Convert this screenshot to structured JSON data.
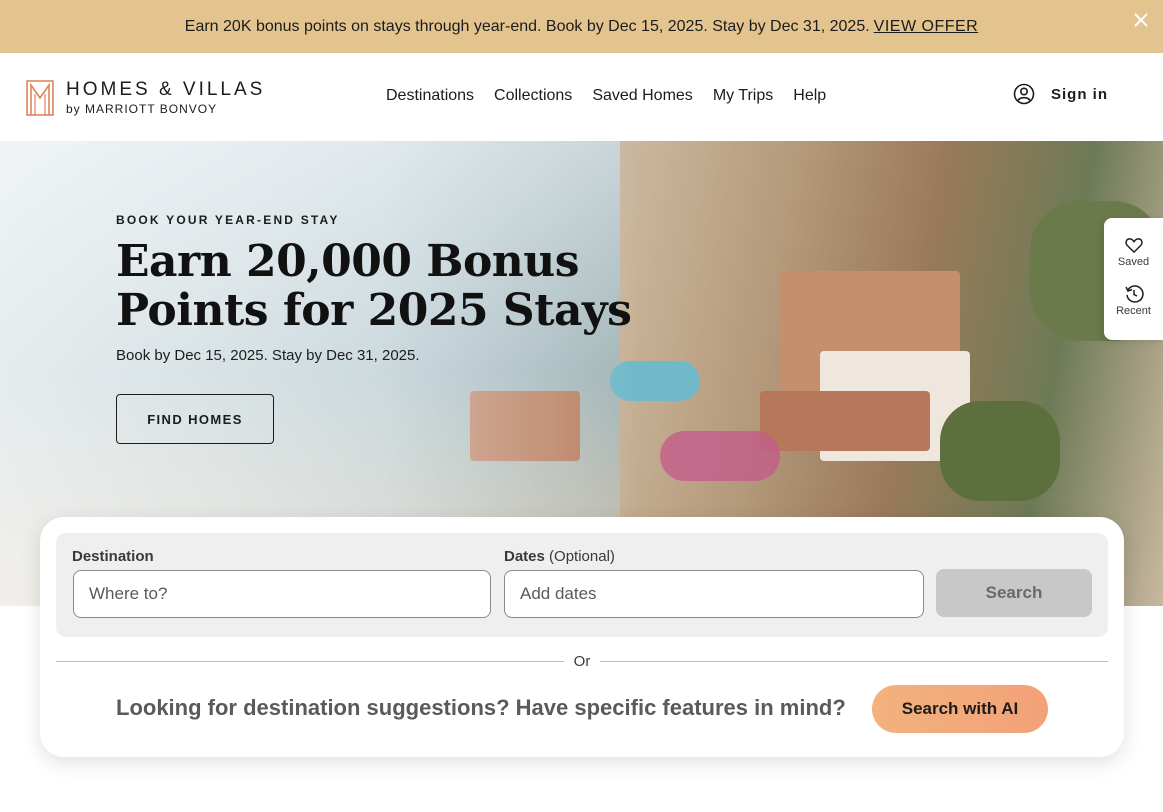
{
  "promo": {
    "text": "Earn 20K bonus points on stays through year-end. Book by Dec 15, 2025. Stay by Dec 31, 2025.",
    "link_label": "VIEW OFFER"
  },
  "header": {
    "logo_title": "HOMES & VILLAS",
    "logo_sub": "by MARRIOTT BONVOY",
    "nav": [
      "Destinations",
      "Collections",
      "Saved Homes",
      "My Trips",
      "Help"
    ],
    "signin_label": "Sign in"
  },
  "hero": {
    "eyebrow": "BOOK YOUR YEAR-END STAY",
    "headline_line1": "Earn 20,000 Bonus",
    "headline_line2": "Points for 2025 Stays",
    "subtext": "Book by Dec 15, 2025. Stay by Dec 31, 2025.",
    "cta_label": "FIND HOMES"
  },
  "side_panel": {
    "saved_label": "Saved",
    "recent_label": "Recent"
  },
  "search": {
    "destination_label": "Destination",
    "destination_placeholder": "Where to?",
    "dates_label": "Dates",
    "dates_optional": "(Optional)",
    "dates_placeholder": "Add dates",
    "search_label": "Search",
    "or_label": "Or",
    "ai_prompt": "Looking for destination suggestions? Have specific features in mind?",
    "ai_button_label": "Search with AI"
  },
  "colors": {
    "promo_bg": "#e3c48e",
    "logo_accent": "#e0835e",
    "ai_button": "#f3a178",
    "search_disabled": "#c8c8c8"
  }
}
